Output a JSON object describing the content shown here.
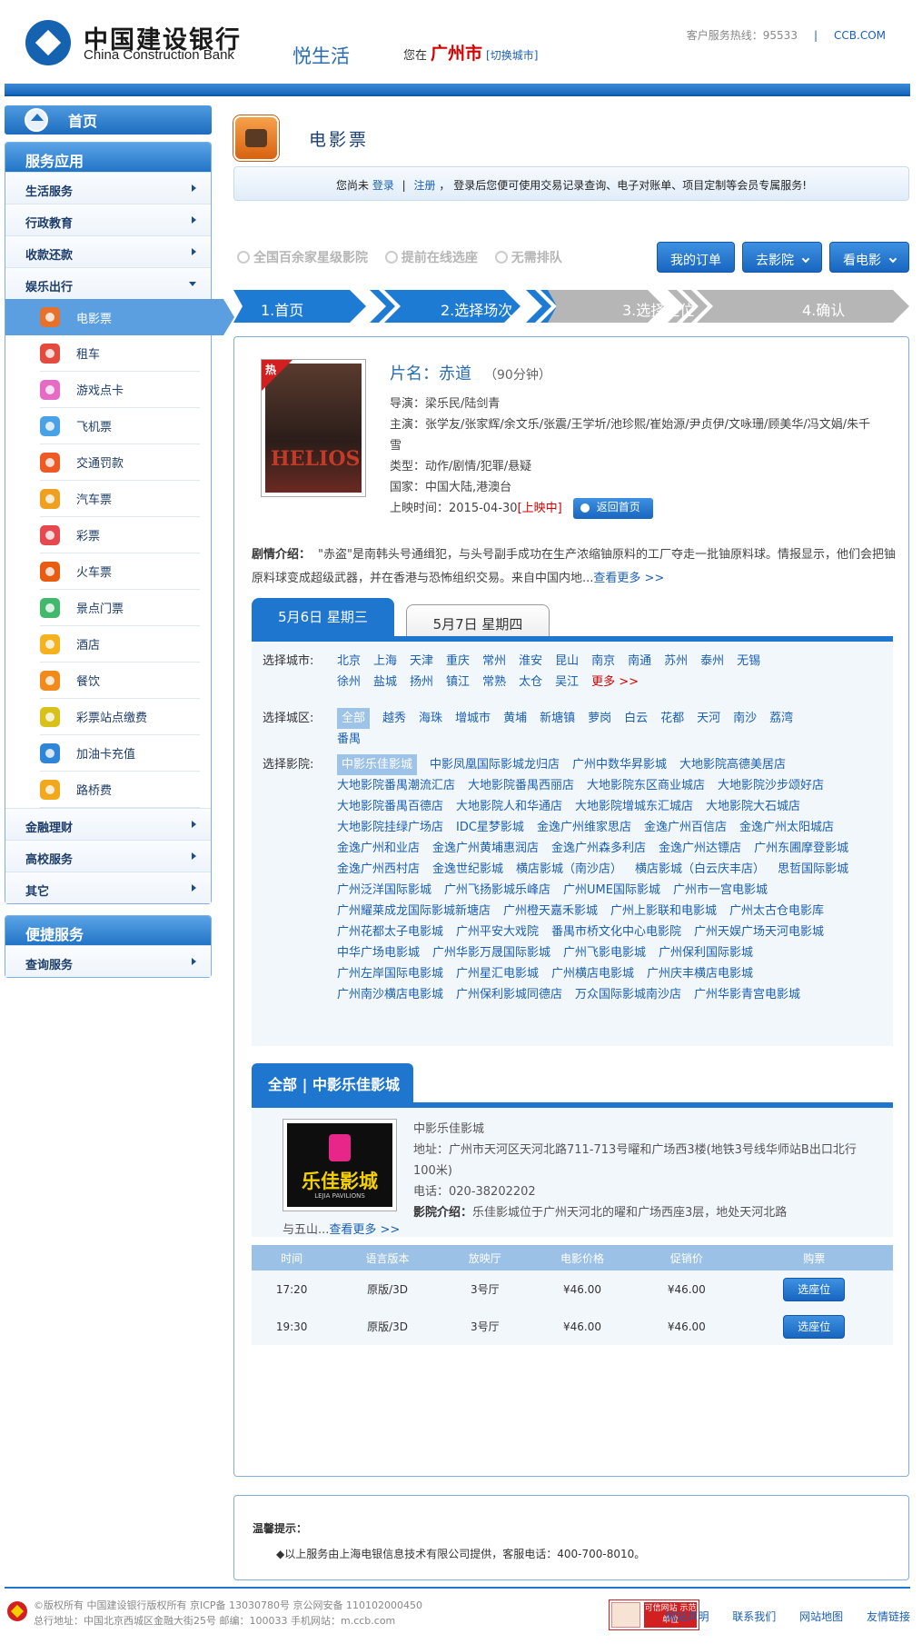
{
  "header": {
    "logo_cn": "中国建设银行",
    "logo_en": "China Construction Bank",
    "brand_sub": "悦生活",
    "loc_prefix": "您在",
    "city": "广州市",
    "switch_city": "[切换城市]",
    "hotline": "客户服务热线：95533",
    "hotline_sep": "|",
    "site": "CCB.COM"
  },
  "sidebar": {
    "home": "首页",
    "service_title": "服务应用",
    "categories": [
      "生活服务",
      "行政教育",
      "收款还款",
      "娱乐出行"
    ],
    "subitems": [
      "电影票",
      "租车",
      "游戏点卡",
      "飞机票",
      "交通罚款",
      "汽车票",
      "彩票",
      "火车票",
      "景点门票",
      "酒店",
      "餐饮",
      "彩票站点缴费",
      "加油卡充值",
      "路桥费"
    ],
    "categories_bottom": [
      "金融理财",
      "高校服务",
      "其它"
    ],
    "quick_title": "便捷服务",
    "quick_item": "查询服务"
  },
  "main": {
    "title": "电影票",
    "login_bar": {
      "prefix": "您尚未",
      "login": "登录",
      "sep": "|",
      "register": "注册",
      "suffix": "，  登录后您便可使用交易记录查询、电子对账单、项目定制等会员专属服务!"
    },
    "features": [
      "全国百余家星级影院",
      "提前在线选座",
      "无需排队"
    ],
    "buttons": {
      "orders": "我的订单",
      "cinema": "去影院",
      "movie": "看电影"
    },
    "steps": [
      "1.首页",
      "2.选择场次",
      "3.选择座位",
      "4.确认"
    ]
  },
  "movie": {
    "hot_badge": "热",
    "poster_text": "HELIOS",
    "title_label": "片名：",
    "title": "赤道",
    "duration": "（90分钟）",
    "director": "导演：梁乐民/陆剑青",
    "cast": "主演：张学友/张家辉/余文乐/张震/王学圻/池珍熙/崔始源/尹贞伊/文咏珊/顾美华/冯文娟/朱千雪",
    "genre": "类型：动作/剧情/犯罪/悬疑",
    "country": "国家：中国大陆,港澳台",
    "release_label": "上映时间：2015-04-30",
    "status": "[上映中]",
    "back_button": "返回首页",
    "synopsis_label": "剧情介绍：",
    "synopsis": "\"赤盗\"是南韩头号通缉犯，与头号副手成功在生产浓缩铀原料的工厂夺走一批铀原料球。情报显示，他们会把铀原料球变成超级武器，并在香港与恐怖组织交易。来自中国内地...",
    "more": "查看更多 >>"
  },
  "dates": [
    "5月6日 星期三",
    "5月7日 星期四"
  ],
  "filters": {
    "city_label": "选择城市:",
    "cities": [
      "北京",
      "上海",
      "天津",
      "重庆",
      "常州",
      "淮安",
      "昆山",
      "南京",
      "南通",
      "苏州",
      "泰州",
      "无锡",
      "徐州",
      "盐城",
      "扬州",
      "镇江",
      "常熟",
      "太仓",
      "吴江"
    ],
    "city_more": "更多 >>",
    "district_label": "选择城区:",
    "districts": [
      "全部",
      "越秀",
      "海珠",
      "增城市",
      "黄埔",
      "新塘镇",
      "萝岗",
      "白云",
      "花都",
      "天河",
      "南沙",
      "荔湾",
      "番禺"
    ],
    "cinema_label": "选择影院:",
    "cinemas": [
      "中影乐佳影城",
      "中影凤凰国际影城龙归店",
      "广州中数华昇影城",
      "大地影院高德美居店",
      "大地影院番禺潮流汇店",
      "大地影院番禺西丽店",
      "大地影院东区商业城店",
      "大地影院沙步颂好店",
      "大地影院番禺百德店",
      "大地影院人和华通店",
      "大地影院增城东汇城店",
      "大地影院大石城店",
      "大地影院挂绿广场店",
      "IDC星梦影城",
      "金逸广州维家思店",
      "金逸广州百信店",
      "金逸广州太阳城店",
      "金逸广州和业店",
      "金逸广州黄埔惠润店",
      "金逸广州森多利店",
      "金逸广州达镖店",
      "广州东圃摩登影城",
      "金逸广州西村店",
      "金逸世纪影城",
      "横店影城（南沙店）",
      "横店影城（白云庆丰店）",
      "思哲国际影城",
      "广州泛洋国际影城",
      "广州飞扬影城乐峰店",
      "广州UME国际影城",
      "广州市一宫电影城",
      "广州耀莱成龙国际影城新塘店",
      "广州橙天嘉禾影城",
      "广州上影联和电影城",
      "广州太古仓电影库",
      "广州花都太子电影城",
      "广州平安大戏院",
      "番禺市桥文化中心电影院",
      "广州天娱广场天河电影城",
      "中华广场电影城",
      "广州华影万晟国际影城",
      "广州飞影电影城",
      "广州保利国际影城",
      "广州左岸国际电影城",
      "广州星汇电影城",
      "广州横店电影城",
      "广州庆丰横店电影城",
      "广州南沙横店电影城",
      "广州保利影城同德店",
      "万众国际影城南沙店",
      "广州华影青宫电影城"
    ]
  },
  "cinema": {
    "tab": "全部 | 中影乐佳影城",
    "logo_text": "乐佳影城",
    "logo_sub": "LEJIA PAVILIONS",
    "name": "中影乐佳影城",
    "address": "地址：广州市天河区天河北路711-713号曜和广场西3楼(地铁3号线华师站B出口北行100米)",
    "phone": "电话：020-38202202",
    "intro_label": "影院介绍：",
    "intro": "乐佳影城位于广州天河北的曜和广场西座3层，地处天河北路",
    "intro_rest": "与五山...",
    "more": "查看更多 >>"
  },
  "showtimes": {
    "headers": [
      "时间",
      "语言版本",
      "放映厅",
      "电影价格",
      "促销价",
      "购票"
    ],
    "rows": [
      {
        "time": "17:20",
        "version": "原版/3D",
        "hall": "3号厅",
        "price": "¥46.00",
        "promo": "¥46.00",
        "action": "选座位"
      },
      {
        "time": "19:30",
        "version": "原版/3D",
        "hall": "3号厅",
        "price": "¥46.00",
        "promo": "¥46.00",
        "action": "选座位"
      }
    ]
  },
  "tips": {
    "title": "温馨提示：",
    "text": "◆以上服务由上海电银信息技术有限公司提供，客服电话：400-700-8010。"
  },
  "footer": {
    "line1": "©版权所有 中国建设银行版权所有 京ICP备 13030780号 京公网安备 110102000450",
    "line2": "总行地址：中国北京西城区金融大街25号      邮编：100033      手机网站：m.ccb.com",
    "trust_badge": "可信网站 示范单位",
    "links": [
      "网站声明",
      "联系我们",
      "网站地图",
      "友情链接"
    ]
  }
}
